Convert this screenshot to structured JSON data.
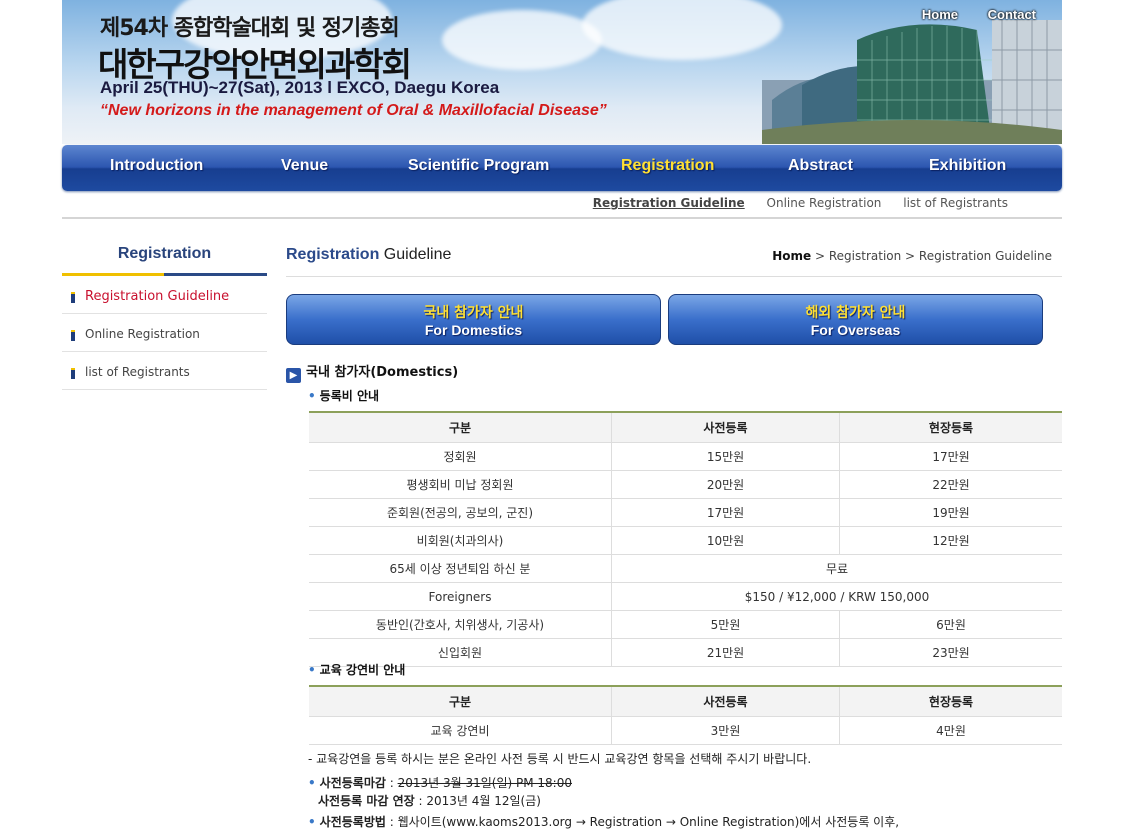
{
  "banner": {
    "line1": "제54차 종합학술대회 및 정기총회",
    "line2": "대한구강악안면외과학회",
    "line3": "April 25(THU)~27(Sat), 2013 l EXCO, Daegu Korea",
    "line4": "“New horizons in the management of Oral & Maxillofacial Disease”"
  },
  "toplinks": {
    "home": "Home",
    "contact": "Contact"
  },
  "nav": [
    "Introduction",
    "Venue",
    "Scientific Program",
    "Registration",
    "Abstract",
    "Exhibition"
  ],
  "subnav": [
    "Registration Guideline",
    "Online Registration",
    "list of Registrants"
  ],
  "sidebar": {
    "title": "Registration",
    "items": [
      "Registration Guideline",
      "Online Registration",
      "list of Registrants"
    ]
  },
  "content": {
    "title_bold": "Registration",
    "title_rest": " Guideline",
    "breadcrumb": {
      "home": "Home",
      "sep1": " > ",
      "level1": "Registration",
      "sep2": " > ",
      "level2": "Registration Guideline"
    },
    "btn_domestic": {
      "ko": "국내 참가자 안내",
      "en": "For Domestics"
    },
    "btn_overseas": {
      "ko": "해외 참가자 안내",
      "en": "For Overseas"
    },
    "section": "국내 참가자(Domestics)",
    "fee_title": "등록비 안내",
    "fee_headers": [
      "구분",
      "사전등록",
      "현장등록"
    ],
    "fee_rows": [
      [
        "정회원",
        "15만원",
        "17만원"
      ],
      [
        "평생회비 미납 정회원",
        "20만원",
        "22만원"
      ],
      [
        "준회원(전공의, 공보의, 군진)",
        "17만원",
        "19만원"
      ],
      [
        "비회원(치과의사)",
        "10만원",
        "12만원"
      ],
      [
        "65세 이상 정년퇴임 하신 분",
        "무료"
      ],
      [
        "Foreigners",
        "$150 /  ¥12,000 / KRW 150,000"
      ],
      [
        "동반인(간호사, 치위생사, 기공사)",
        "5만원",
        "6만원"
      ],
      [
        "신입회원",
        "21만원",
        "23만원"
      ]
    ],
    "edu_title": "교육 강연비 안내",
    "edu_headers": [
      "구분",
      "사전등록",
      "현장등록"
    ],
    "edu_rows": [
      [
        "교육 강연비",
        "3만원",
        "4만원"
      ]
    ],
    "note1": "- 교육강연을 등록 하시는 분은 온라인 사전 등록 시 반드시 교육강연 항목을 선택해 주시기 바랍니다.",
    "deadline_label": "사전등록마감",
    "deadline_colon": " : ",
    "deadline_old": "2013년 3월 31일(일) PM 18:00",
    "extend_label": "사전등록 마감 연장",
    "extend_colon": " : ",
    "extend_value": "2013년 4월 12일(금)",
    "method_label": "사전등록방법",
    "method_colon": " : ",
    "method_value": "웹사이트(www.kaoms2013.org → Registration → Online Registration)에서 사전등록 이후,"
  },
  "colors": {
    "nav_active": "#ffe033",
    "sidebar_active": "#c8102e",
    "brand_blue": "#2b4a8a",
    "table_border": "#8ca05a"
  }
}
